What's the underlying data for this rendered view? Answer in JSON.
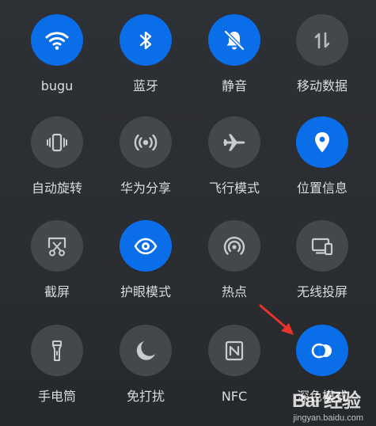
{
  "tiles": [
    {
      "label": "bugu",
      "icon": "wifi-icon",
      "active": true
    },
    {
      "label": "蓝牙",
      "icon": "bluetooth-icon",
      "active": true
    },
    {
      "label": "静音",
      "icon": "bell-off-icon",
      "active": true
    },
    {
      "label": "移动数据",
      "icon": "mobile-data-icon",
      "active": false
    },
    {
      "label": "自动旋转",
      "icon": "auto-rotate-icon",
      "active": false
    },
    {
      "label": "华为分享",
      "icon": "huawei-share-icon",
      "active": false
    },
    {
      "label": "飞行模式",
      "icon": "airplane-icon",
      "active": false
    },
    {
      "label": "位置信息",
      "icon": "location-icon",
      "active": true
    },
    {
      "label": "截屏",
      "icon": "screenshot-icon",
      "active": false
    },
    {
      "label": "护眼模式",
      "icon": "eye-icon",
      "active": true
    },
    {
      "label": "热点",
      "icon": "hotspot-icon",
      "active": false
    },
    {
      "label": "无线投屏",
      "icon": "wireless-projection-icon",
      "active": false
    },
    {
      "label": "手电筒",
      "icon": "flashlight-icon",
      "active": false
    },
    {
      "label": "免打扰",
      "icon": "moon-icon",
      "active": false
    },
    {
      "label": "NFC",
      "icon": "nfc-icon",
      "active": false
    },
    {
      "label": "深色模式",
      "icon": "dark-mode-icon",
      "active": true
    }
  ],
  "colors": {
    "active": "#0a6ee8",
    "inactive": "#44484d",
    "annotation_arrow": "#e8322c"
  },
  "watermark": {
    "logo": "Bai 经验",
    "url": "jingyan.baidu.com"
  }
}
